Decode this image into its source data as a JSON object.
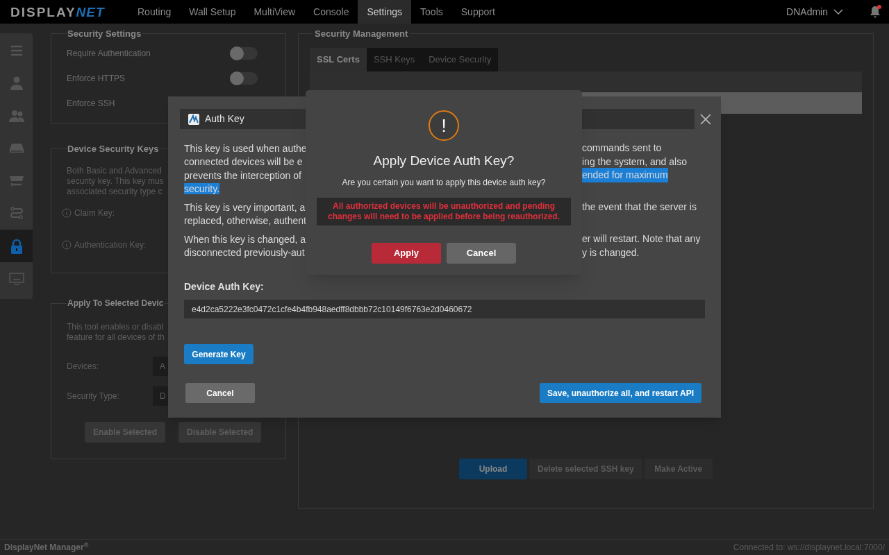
{
  "logo": {
    "first": "DISPLAY",
    "second": "NET"
  },
  "nav": [
    {
      "label": "Routing",
      "selected": false
    },
    {
      "label": "Wall Setup",
      "selected": false
    },
    {
      "label": "MultiView",
      "selected": false
    },
    {
      "label": "Console",
      "selected": false
    },
    {
      "label": "Settings",
      "selected": true
    },
    {
      "label": "Tools",
      "selected": false
    },
    {
      "label": "Support",
      "selected": false
    }
  ],
  "user": "DNAdmin",
  "notifications": {
    "unread": true
  },
  "sidebar": [
    {
      "kind": "menu",
      "selected": false
    },
    {
      "kind": "user",
      "selected": false
    },
    {
      "kind": "users",
      "selected": false
    },
    {
      "kind": "drive",
      "selected": false
    },
    {
      "kind": "serial",
      "selected": false
    },
    {
      "kind": "route",
      "selected": false
    },
    {
      "kind": "lock",
      "selected": true
    },
    {
      "kind": "monitor",
      "selected": false
    }
  ],
  "security_settings": {
    "title": "Security Settings",
    "toggles": [
      {
        "label": "Require Authentication",
        "on": false
      },
      {
        "label": "Enforce HTTPS",
        "on": false
      },
      {
        "label": "Enforce SSH"
      }
    ]
  },
  "device_security_keys": {
    "title": "Device Security Keys",
    "description": [
      "Both Basic and Advanced",
      "security key. This key mus",
      "associated security type c"
    ],
    "fields": [
      "Claim Key:",
      "Authentication Key:"
    ]
  },
  "apply_to_selected": {
    "title": "Apply To Selected Devic",
    "description": [
      "This tool enables or disabl",
      "feature for all devices of th"
    ],
    "selects": [
      {
        "label": "Devices:",
        "value": "A"
      },
      {
        "label": "Security Type:",
        "value": "D"
      }
    ],
    "buttons": [
      "Enable Selected",
      "Disable Selected"
    ]
  },
  "security_management": {
    "title": "Security Management",
    "tabs": [
      {
        "label": "SSL Certs",
        "selected": true
      },
      {
        "label": "SSH Keys",
        "selected": false
      },
      {
        "label": "Device Security",
        "selected": false
      }
    ],
    "buttons": [
      {
        "label": "Upload",
        "disabled": false
      },
      {
        "label": "Delete selected SSH key",
        "disabled": true
      },
      {
        "label": "Make Active",
        "disabled": true
      }
    ]
  },
  "status_bar": {
    "app": "DisplayNet Manager",
    "mark": "®",
    "connection": "Connected to: ws://displaynet.local:7000/"
  },
  "auth_dialog": {
    "title": "Auth Key",
    "paragraphs": [
      [
        {
          "left": {
            "text": "This key is used when authe",
            "highlighted": false
          },
          "right": {
            "text": "commands sent to",
            "highlighted": false
          }
        },
        {
          "left": {
            "text": "connected devices will be e",
            "highlighted": false
          },
          "right": {
            "text": "ing the system, and also",
            "highlighted": false
          }
        },
        {
          "left": {
            "text": "prevents the interception of",
            "highlighted": false
          },
          "right": {
            "text": "ended for maximum",
            "highlighted": true
          }
        },
        {
          "left": {
            "text": "security.",
            "highlighted": true
          }
        }
      ],
      [
        {
          "left": {
            "text": "This key is very important, a",
            "highlighted": false
          },
          "right": {
            "text": "the event that the server is",
            "highlighted": false
          }
        },
        {
          "left": {
            "text": "replaced, otherwise, authent",
            "highlighted": false
          }
        }
      ],
      [
        {
          "left": {
            "text": "When this key is changed, a",
            "highlighted": false
          },
          "right": {
            "text": "er will restart. Note that any",
            "highlighted": false
          }
        },
        {
          "left": {
            "text": "disconnected previously-aut",
            "highlighted": false
          },
          "right": {
            "text": "y is changed.",
            "highlighted": false
          }
        }
      ]
    ],
    "key_label": "Device Auth Key:",
    "key_value": "e4d2ca5222e3fc0472c1cfe4b4fb948aedff8dbbb72c10149f6763e2d0460672",
    "generate": "Generate Key",
    "cancel": "Cancel",
    "save": "Save, unauthorize all, and restart API"
  },
  "confirm_dialog": {
    "icon": "!",
    "title": "Apply Device Auth Key?",
    "message": "Are you certain you want to apply this device auth key?",
    "warning": [
      "All authorized devices will be unauthorized and pending",
      "changes will need to be applied before being reauthorized."
    ],
    "apply": "Apply",
    "cancel": "Cancel"
  }
}
